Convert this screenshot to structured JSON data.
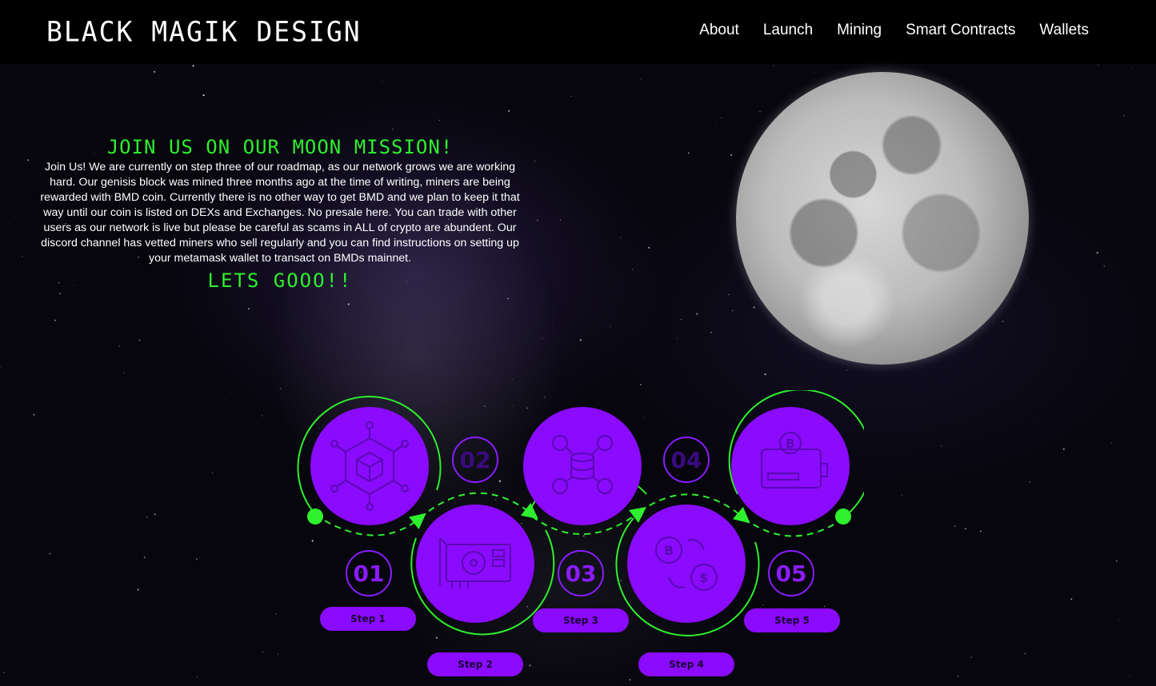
{
  "header": {
    "logo": "BLACK MAGIK DESIGN",
    "nav": [
      "About",
      "Launch",
      "Mining",
      "Smart Contracts",
      "Wallets"
    ]
  },
  "intro": {
    "heading": "JOIN US ON OUR MOON MISSION!",
    "body": "Join Us! We are currently on step three of our roadmap, as our network grows we are working hard. Our genisis block was mined three months ago at the time of writing, miners are being rewarded with BMD coin. Currently there is no other way to get BMD and we plan to keep it that way until our coin is listed on DEXs and Exchanges. No presale here. You can trade with other users as our network is live but please be careful as scams in ALL of crypto are abundent. Our discord channel has vetted miners who sell regularly and you can find instructions on setting up your metamask wallet to transact on BMDs mainnet.",
    "cta": "LETS GOOO!!"
  },
  "roadmap": {
    "steps": [
      {
        "number": "01",
        "label": "Step 1",
        "icon": "blockchain-cube-icon"
      },
      {
        "number": "02",
        "label": "Step 2",
        "icon": "graphics-card-icon"
      },
      {
        "number": "03",
        "label": "Step 3",
        "icon": "database-network-icon"
      },
      {
        "number": "04",
        "label": "Step 4",
        "icon": "crypto-exchange-icon"
      },
      {
        "number": "05",
        "label": "Step 5",
        "icon": "bitcoin-wallet-icon"
      }
    ]
  },
  "colors": {
    "accent_green": "#2ef02e",
    "accent_purple": "#8a0bff",
    "background": "#000000"
  }
}
